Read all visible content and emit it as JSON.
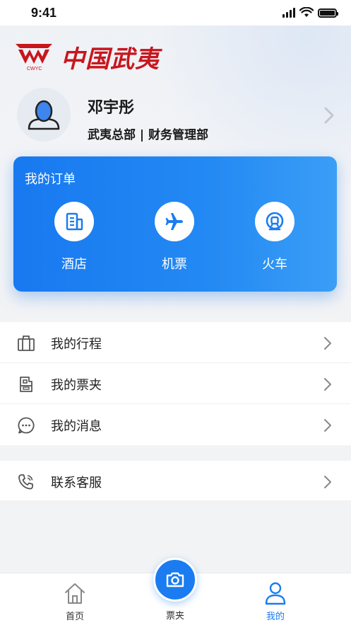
{
  "status_bar": {
    "time": "9:41"
  },
  "brand": {
    "logo_text": "中国武夷",
    "logo_sub": "CWYC"
  },
  "profile": {
    "name": "邓宇彤",
    "department": "武夷总部 | 财务管理部"
  },
  "orders": {
    "title": "我的订单",
    "items": [
      {
        "label": "酒店",
        "icon": "hotel-icon"
      },
      {
        "label": "机票",
        "icon": "plane-icon"
      },
      {
        "label": "火车",
        "icon": "train-icon"
      }
    ]
  },
  "menu": {
    "items": [
      {
        "label": "我的行程",
        "icon": "luggage-icon"
      },
      {
        "label": "我的票夹",
        "icon": "ticket-folder-icon"
      },
      {
        "label": "我的消息",
        "icon": "message-icon"
      }
    ],
    "service": {
      "label": "联系客服",
      "icon": "phone-icon"
    }
  },
  "tabbar": {
    "home": "首页",
    "tickets": "票夹",
    "mine": "我的"
  },
  "colors": {
    "primary": "#1a7cf0",
    "brand_red": "#c8161d"
  }
}
